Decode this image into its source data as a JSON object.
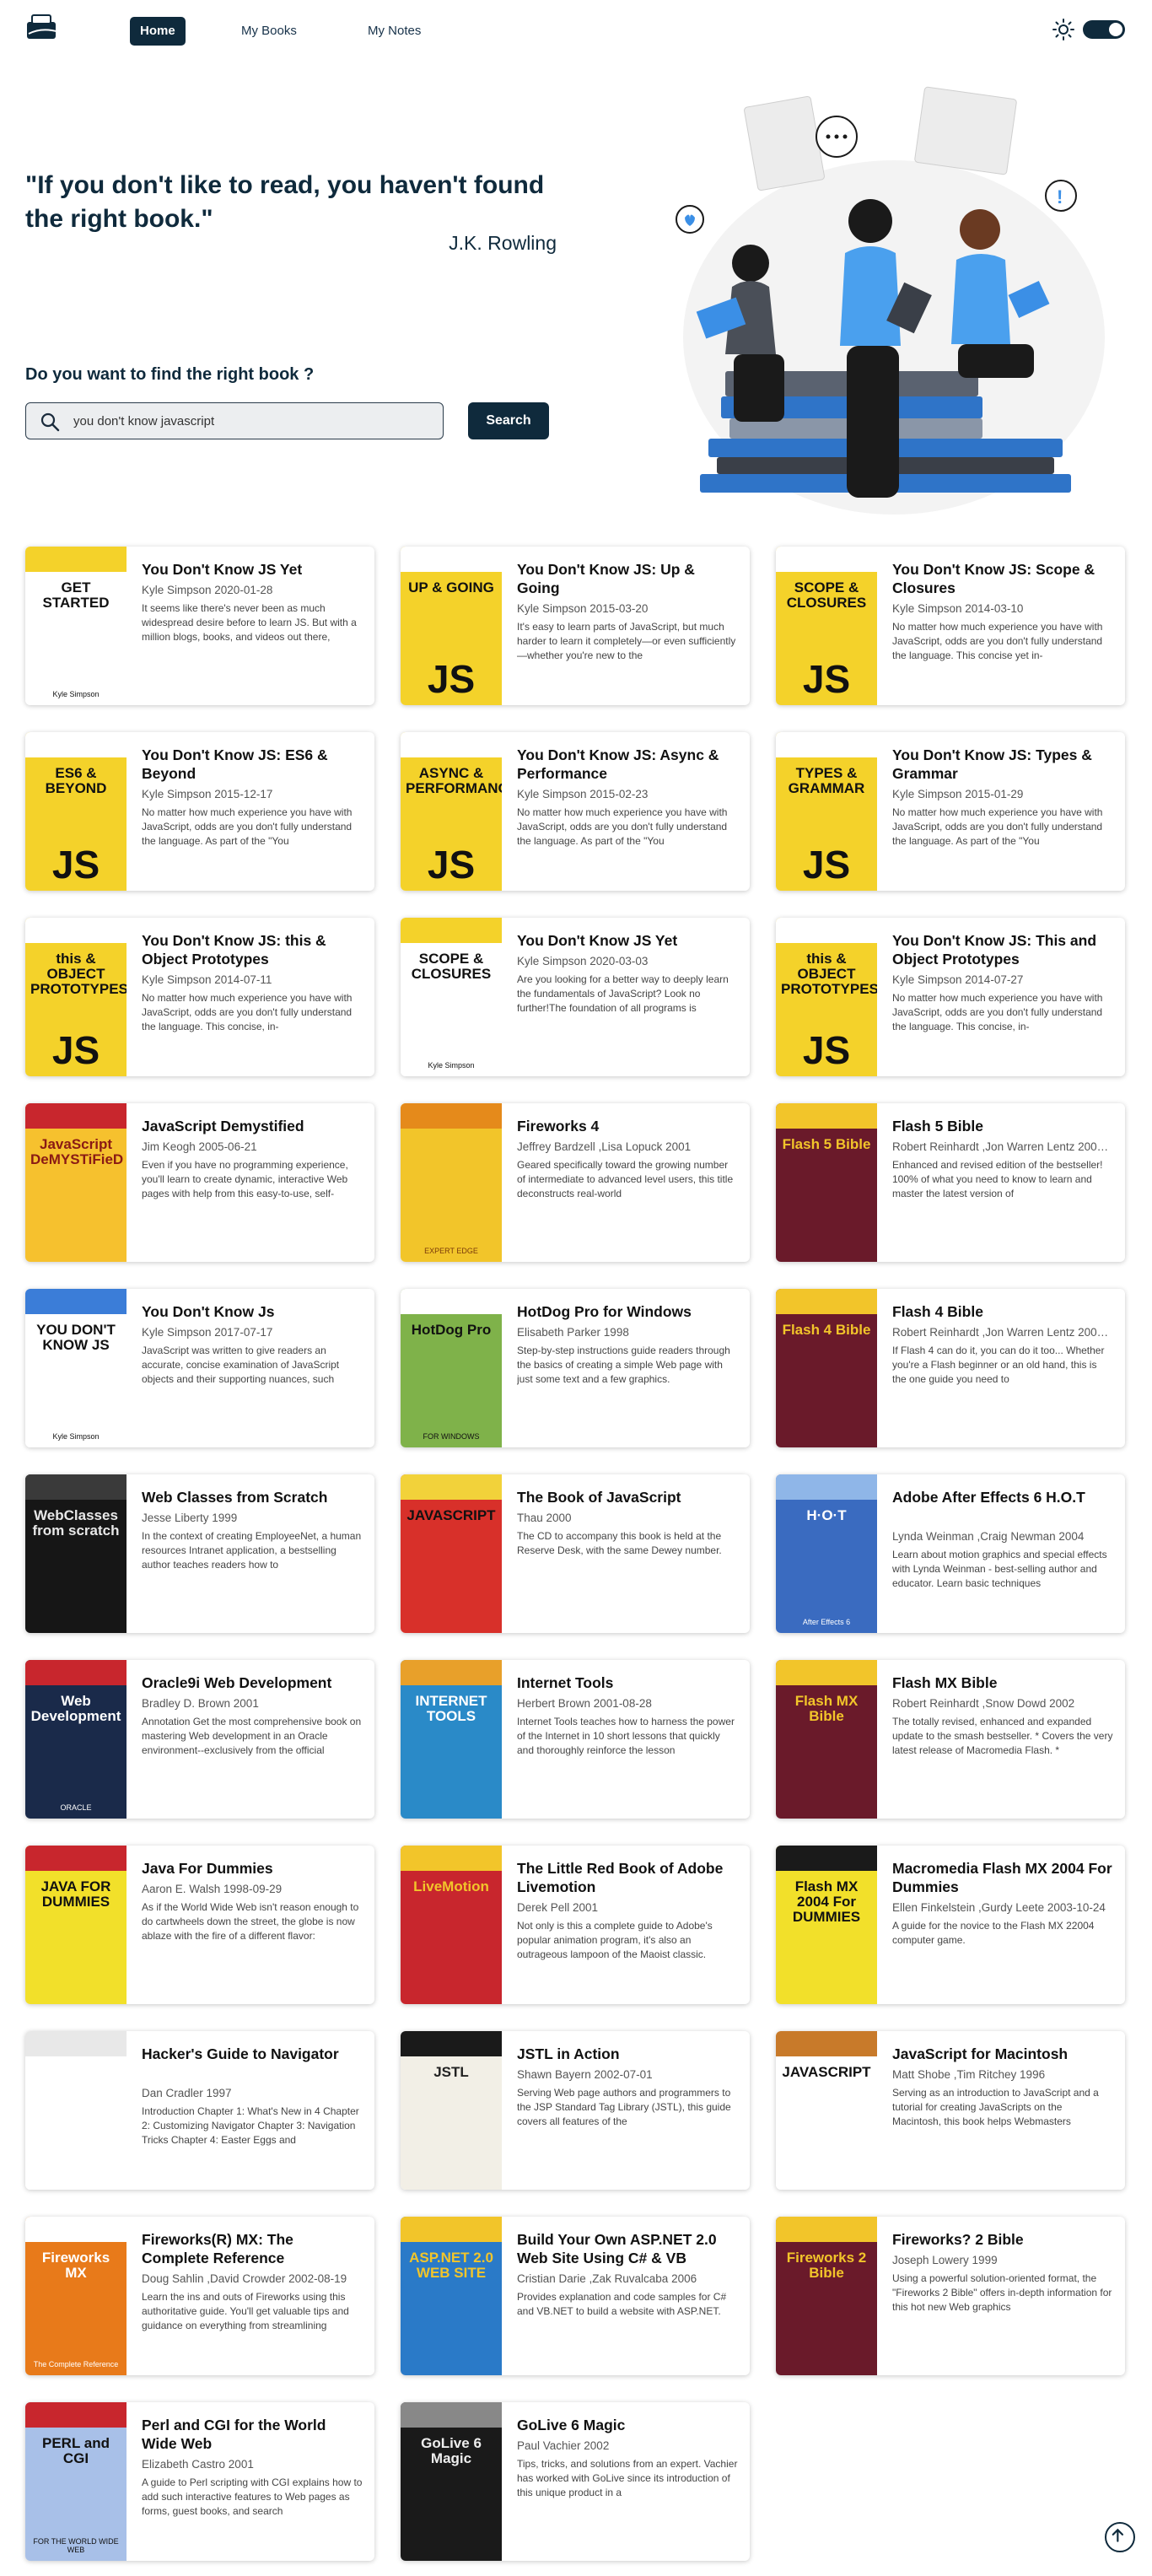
{
  "nav": {
    "home": "Home",
    "my_books": "My Books",
    "my_notes": "My Notes"
  },
  "hero": {
    "quote": "\"If you don't like to read, you haven't found the right book.\"",
    "author": "J.K. Rowling",
    "question": "Do you want to find the right book ?"
  },
  "search": {
    "value": "you don't know javascript",
    "button": "Search"
  },
  "books": [
    {
      "title": "You Don't Know JS Yet",
      "meta": "Kyle Simpson 2020-01-28",
      "desc": "It seems like there's never been as much widespread desire before to learn JS. But with a million blogs, books, and videos out there,",
      "cover": "GET STARTED",
      "cover_sub": "Kyle Simpson",
      "bg": "#ffffff",
      "accent": "#f4d22a",
      "fg": "#111111"
    },
    {
      "title": "You Don't Know JS: Up & Going",
      "meta": "Kyle Simpson 2015-03-20",
      "desc": "It's easy to learn parts of JavaScript, but much harder to learn it completely—or even sufficiently—whether you're new to the",
      "cover": "UP & GOING",
      "cover_sub": "JS",
      "bg": "#f4d22a",
      "accent": "#ffffff",
      "fg": "#111111"
    },
    {
      "title": "You Don't Know JS: Scope & Closures",
      "meta": "Kyle Simpson 2014-03-10",
      "desc": "No matter how much experience you have with JavaScript, odds are you don't fully understand the language. This concise yet in-",
      "cover": "SCOPE & CLOSURES",
      "cover_sub": "JS",
      "bg": "#f4d22a",
      "accent": "#ffffff",
      "fg": "#111111"
    },
    {
      "title": "You Don't Know JS: ES6 & Beyond",
      "meta": "Kyle Simpson 2015-12-17",
      "desc": "No matter how much experience you have with JavaScript, odds are you don't fully understand the language. As part of the \"You",
      "cover": "ES6 & BEYOND",
      "cover_sub": "JS",
      "bg": "#f4d22a",
      "accent": "#ffffff",
      "fg": "#111111"
    },
    {
      "title": "You Don't Know JS: Async & Performance",
      "meta": "Kyle Simpson 2015-02-23",
      "desc": "No matter how much experience you have with JavaScript, odds are you don't fully understand the language. As part of the \"You",
      "cover": "ASYNC & PERFORMANCE",
      "cover_sub": "JS",
      "bg": "#f4d22a",
      "accent": "#ffffff",
      "fg": "#111111"
    },
    {
      "title": "You Don't Know JS: Types & Grammar",
      "meta": "Kyle Simpson 2015-01-29",
      "desc": "No matter how much experience you have with JavaScript, odds are you don't fully understand the language. As part of the \"You",
      "cover": "TYPES & GRAMMAR",
      "cover_sub": "JS",
      "bg": "#f4d22a",
      "accent": "#ffffff",
      "fg": "#111111"
    },
    {
      "title": "You Don't Know JS: this & Object Prototypes",
      "meta": "Kyle Simpson 2014-07-11",
      "desc": "No matter how much experience you have with JavaScript, odds are you don't fully understand the language. This concise, in-",
      "cover": "this & OBJECT PROTOTYPES",
      "cover_sub": "JS",
      "bg": "#f4d22a",
      "accent": "#ffffff",
      "fg": "#111111"
    },
    {
      "title": "You Don't Know JS Yet",
      "meta": "Kyle Simpson 2020-03-03",
      "desc": "Are you looking for a better way to deeply learn the fundamentals of JavaScript? Look no further!The foundation of all programs is",
      "cover": "SCOPE & CLOSURES",
      "cover_sub": "Kyle Simpson",
      "bg": "#ffffff",
      "accent": "#f4d22a",
      "fg": "#111111"
    },
    {
      "title": "You Don't Know JS: This and Object Prototypes",
      "meta": "Kyle Simpson 2014-07-27",
      "desc": "No matter how much experience you have with JavaScript, odds are you don't fully understand the language. This concise, in-",
      "cover": "this & OBJECT PROTOTYPES",
      "cover_sub": "JS",
      "bg": "#f4d22a",
      "accent": "#ffffff",
      "fg": "#111111"
    },
    {
      "title": "JavaScript Demystified",
      "meta": "Jim Keogh 2005-06-21",
      "desc": "Even if you have no programming experience, you'll learn to create dynamic, interactive Web pages with help from this easy-to-use, self-",
      "cover": "JavaScript DeMYSTiFieD",
      "cover_sub": "",
      "bg": "#f6c12e",
      "accent": "#c8262d",
      "fg": "#8a1a14"
    },
    {
      "title": "Fireworks 4",
      "meta": "Jeffrey Bardzell ,Lisa Lopuck 2001",
      "desc": "Geared specifically toward the growing number of intermediate to advanced level users, this title deconstructs real-world",
      "cover": "",
      "cover_sub": "EXPERT EDGE",
      "bg": "#f2c52a",
      "accent": "#e58a1b",
      "fg": "#7a3a0a"
    },
    {
      "title": "Flash 5 Bible",
      "meta": "Robert Reinhardt ,Jon Warren Lentz 2001-03-01",
      "desc": "Enhanced and revised edition of the bestseller! 100% of what you need to know to learn and master the latest version of",
      "cover": "Flash 5 Bible",
      "cover_sub": "",
      "bg": "#6a1a2a",
      "accent": "#f2c52a",
      "fg": "#f2c52a"
    },
    {
      "title": "You Don't Know Js",
      "meta": "Kyle Simpson 2017-07-17",
      "desc": "JavaScript was written to give readers an accurate, concise examination of JavaScript objects and their supporting nuances, such",
      "cover": "YOU DON'T KNOW JS",
      "cover_sub": "Kyle Simpson",
      "bg": "#ffffff",
      "accent": "#3b7dd8",
      "fg": "#111111"
    },
    {
      "title": "HotDog Pro for Windows",
      "meta": "Elisabeth Parker 1998",
      "desc": "Step-by-step instructions guide readers through the basics of creating a simple Web page with just some text and a few graphics.",
      "cover": "HotDog Pro",
      "cover_sub": "FOR WINDOWS",
      "bg": "#7fb24a",
      "accent": "#ffffff",
      "fg": "#111111"
    },
    {
      "title": "Flash 4 Bible",
      "meta": "Robert Reinhardt ,Jon Warren Lentz 2000-02-25",
      "desc": "If Flash 4 can do it, you can do it too... Whether you're a Flash beginner or an old hand, this is the one guide you need to",
      "cover": "Flash 4 Bible",
      "cover_sub": "",
      "bg": "#6a1a2a",
      "accent": "#f2c52a",
      "fg": "#f2c52a"
    },
    {
      "title": "Web Classes from Scratch",
      "meta": "Jesse Liberty 1999",
      "desc": "In the context of creating EmployeeNet, a human resources Intranet application, a bestselling author teaches readers how to",
      "cover": "WebClasses from scratch",
      "cover_sub": "",
      "bg": "#161616",
      "accent": "#3a3a3a",
      "fg": "#e8e8e8"
    },
    {
      "title": "The Book of JavaScript",
      "meta": "Thau 2000",
      "desc": "The CD to accompany this book is held at the Reserve Desk, with the same Dewey number.",
      "cover": "JAVASCRIPT",
      "cover_sub": "",
      "bg": "#d8302a",
      "accent": "#f2d23a",
      "fg": "#111111"
    },
    {
      "title": "Adobe After Effects 6 H.O.T",
      "meta": "Lynda Weinman ,Craig Newman 2004",
      "desc": "Learn about motion graphics and special effects with Lynda Weinman - best-selling author and educator. Learn basic techniques",
      "cover": "H·O·T",
      "cover_sub": "After Effects 6",
      "bg": "#3a6bc0",
      "accent": "#8fb6e8",
      "fg": "#ffffff"
    },
    {
      "title": "Oracle9i Web Development",
      "meta": "Bradley D. Brown 2001",
      "desc": "Annotation Get the most comprehensive book on mastering Web development in an Oracle environment--exclusively from the official",
      "cover": "Web Development",
      "cover_sub": "ORACLE",
      "bg": "#1a2a4a",
      "accent": "#c8262d",
      "fg": "#ffffff"
    },
    {
      "title": "Internet Tools",
      "meta": "Herbert Brown 2001-08-28",
      "desc": "Internet Tools teaches how to harness the power of the Internet in 10 short lessons that quickly and thoroughly reinforce the lesson",
      "cover": "INTERNET TOOLS",
      "cover_sub": "",
      "bg": "#2a8ac8",
      "accent": "#e8a02a",
      "fg": "#ffffff"
    },
    {
      "title": "Flash MX Bible",
      "meta": "Robert Reinhardt ,Snow Dowd 2002",
      "desc": "The totally revised, enhanced and expanded update to the smash bestseller. * Covers the very latest release of Macromedia Flash. *",
      "cover": "Flash MX Bible",
      "cover_sub": "",
      "bg": "#6a1a2a",
      "accent": "#f2c52a",
      "fg": "#f2c52a"
    },
    {
      "title": "Java For Dummies",
      "meta": "Aaron E. Walsh 1998-09-29",
      "desc": "As if the World Wide Web isn't reason enough to do cartwheels down the street, the globe is now ablaze with the fire of a different flavor:",
      "cover": "JAVA FOR DUMMIES",
      "cover_sub": "",
      "bg": "#f2e02a",
      "accent": "#c8262d",
      "fg": "#111111"
    },
    {
      "title": "The Little Red Book of Adobe Livemotion",
      "meta": "Derek Pell 2001",
      "desc": "Not only is this a complete guide to Adobe's popular animation program, it's also an outrageous lampoon of the Maoist classic.",
      "cover": "LiveMotion",
      "cover_sub": "",
      "bg": "#c8262d",
      "accent": "#f2c52a",
      "fg": "#f2c52a"
    },
    {
      "title": "Macromedia Flash MX 2004 For Dummies",
      "meta": "Ellen Finkelstein ,Gurdy Leete 2003-10-24",
      "desc": "A guide for the novice to the Flash MX 22004 computer game.",
      "cover": "Flash MX 2004 For DUMMIES",
      "cover_sub": "",
      "bg": "#f2e02a",
      "accent": "#1a1a1a",
      "fg": "#111111"
    },
    {
      "title": "Hacker's Guide to Navigator",
      "meta": "Dan Cradler 1997",
      "desc": "Introduction Chapter 1: What's New in 4 Chapter 2: Customizing Navigator Chapter 3: Navigation Tricks Chapter 4: Easter Eggs and",
      "cover": "",
      "cover_sub": "",
      "bg": "#ffffff",
      "accent": "#e8e8e8",
      "fg": "#666666"
    },
    {
      "title": "JSTL in Action",
      "meta": "Shawn Bayern 2002-07-01",
      "desc": "Serving Web page authors and programmers to the JSP Standard Tag Library (JSTL), this guide covers all features of the",
      "cover": "JSTL",
      "cover_sub": "",
      "bg": "#f2efe6",
      "accent": "#1a1a1a",
      "fg": "#222222"
    },
    {
      "title": "JavaScript for Macintosh",
      "meta": "Matt Shobe ,Tim Ritchey 1996",
      "desc": "Serving as an introduction to JavaScript and a tutorial for creating JavaScripts on the Macintosh, this book helps Webmasters",
      "cover": "JAVASCRIPT",
      "cover_sub": "",
      "bg": "#ffffff",
      "accent": "#c87a2a",
      "fg": "#111111"
    },
    {
      "title": "Fireworks(R) MX: The Complete Reference",
      "meta": "Doug Sahlin ,David Crowder 2002-08-19",
      "desc": "Learn the ins and outs of Fireworks using this authoritative guide. You'll get valuable tips and guidance on everything from streamlining",
      "cover": "Fireworks MX",
      "cover_sub": "The Complete Reference",
      "bg": "#e87a1a",
      "accent": "#ffffff",
      "fg": "#ffffff"
    },
    {
      "title": "Build Your Own ASP.NET 2.0 Web Site Using C# & VB",
      "meta": "Cristian Darie ,Zak Ruvalcaba 2006",
      "desc": "Provides explanation and code samples for C# and VB.NET to build a website with ASP.NET.",
      "cover": "ASP.NET 2.0 WEB SITE",
      "cover_sub": "",
      "bg": "#2a7ac8",
      "accent": "#f2c52a",
      "fg": "#f2c52a"
    },
    {
      "title": "Fireworks? 2 Bible",
      "meta": "Joseph Lowery 1999",
      "desc": "Using a powerful solution-oriented format, the \"Fireworks 2 Bible\" offers in-depth information for this hot new Web graphics",
      "cover": "Fireworks 2 Bible",
      "cover_sub": "",
      "bg": "#6a1a2a",
      "accent": "#f2c52a",
      "fg": "#f2c52a"
    },
    {
      "title": "Perl and CGI for the World Wide Web",
      "meta": "Elizabeth Castro 2001",
      "desc": "A guide to Perl scripting with CGI explains how to add such interactive features to Web pages as forms, guest books, and search",
      "cover": "PERL and CGI",
      "cover_sub": "FOR THE WORLD WIDE WEB",
      "bg": "#a8c0e8",
      "accent": "#c8262d",
      "fg": "#111111"
    },
    {
      "title": "GoLive 6 Magic",
      "meta": "Paul Vachier 2002",
      "desc": "Tips, tricks, and solutions from an expert. Vachier has worked with GoLive since its introduction of this unique product in a",
      "cover": "GoLive 6 Magic",
      "cover_sub": "",
      "bg": "#1a1a1a",
      "accent": "#888888",
      "fg": "#eeeeee"
    }
  ]
}
